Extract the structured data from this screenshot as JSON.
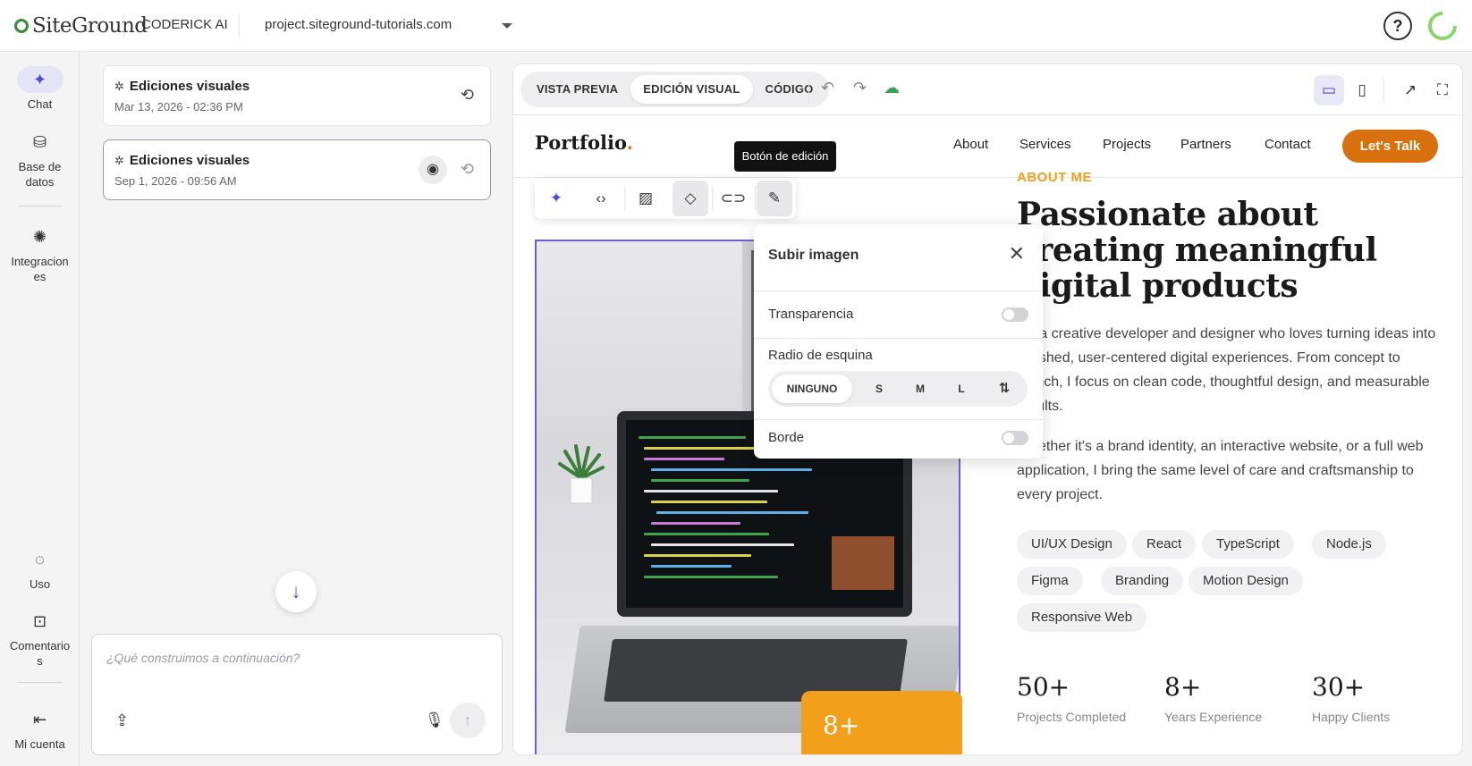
{
  "topbar": {
    "logo": "SiteGround",
    "app": "CODERICK AI",
    "domain": "project.siteground-tutorials.com",
    "help": "?"
  },
  "sidebar": {
    "items": [
      {
        "label": "Chat",
        "icon": "sparkle-icon"
      },
      {
        "label": "Base de datos",
        "icon": "database-icon"
      },
      {
        "label": "Integraciones",
        "icon": "integrations-icon"
      },
      {
        "label": "Uso",
        "icon": "usage-icon"
      },
      {
        "label": "Comentarios",
        "icon": "feedback-icon"
      },
      {
        "label": "Mi cuenta",
        "icon": "account-icon"
      }
    ]
  },
  "history": [
    {
      "title": "Ediciones visuales",
      "date": "Mar 13, 2026 - 02:36 PM"
    },
    {
      "title": "Ediciones visuales",
      "date": "Sep 1, 2026 - 09:56 AM"
    }
  ],
  "composer": {
    "placeholder": "¿Qué construimos a continuación?"
  },
  "editor": {
    "modes": [
      "VISTA PREVIA",
      "EDICIÓN VISUAL",
      "CÓDIGO"
    ],
    "active_mode": "EDICIÓN VISUAL",
    "tooltip": "Botón de edición"
  },
  "site": {
    "brand": "Portfolio",
    "brand_dot": ".",
    "nav": [
      "About",
      "Services",
      "Projects",
      "Partners",
      "Contact"
    ],
    "cta": "Let's Talk",
    "eyebrow": "ABOUT ME",
    "headline": "Passionate about creating meaningful digital products",
    "para1": "I'm a creative developer and designer who loves turning ideas into polished, user-centered digital experiences. From concept to launch, I focus on clean code, thoughtful design, and measurable results.",
    "para2": "Whether it's a brand identity, an interactive website, or a full web application, I bring the same level of care and craftsmanship to every project.",
    "chips": [
      "UI/UX Design",
      "React",
      "TypeScript",
      "Node.js",
      "Figma",
      "Branding",
      "Motion Design",
      "Responsive Web"
    ],
    "badge_number": "8+",
    "stats": [
      {
        "value": "50+",
        "label": "Projects Completed"
      },
      {
        "value": "8+",
        "label": "Years Experience"
      },
      {
        "value": "30+",
        "label": "Happy Clients"
      }
    ]
  },
  "popover": {
    "title": "Subir imagen",
    "transparency_label": "Transparencia",
    "radius_label": "Radio de esquina",
    "radius_options": [
      "NINGUNO",
      "S",
      "M",
      "L"
    ],
    "radius_selected": "NINGUNO",
    "border_label": "Borde",
    "transparency_on": false,
    "border_on": false
  },
  "colors": {
    "accent": "#4c4fd4",
    "cta": "#d9700e",
    "eyebrow": "#f2a01c"
  }
}
